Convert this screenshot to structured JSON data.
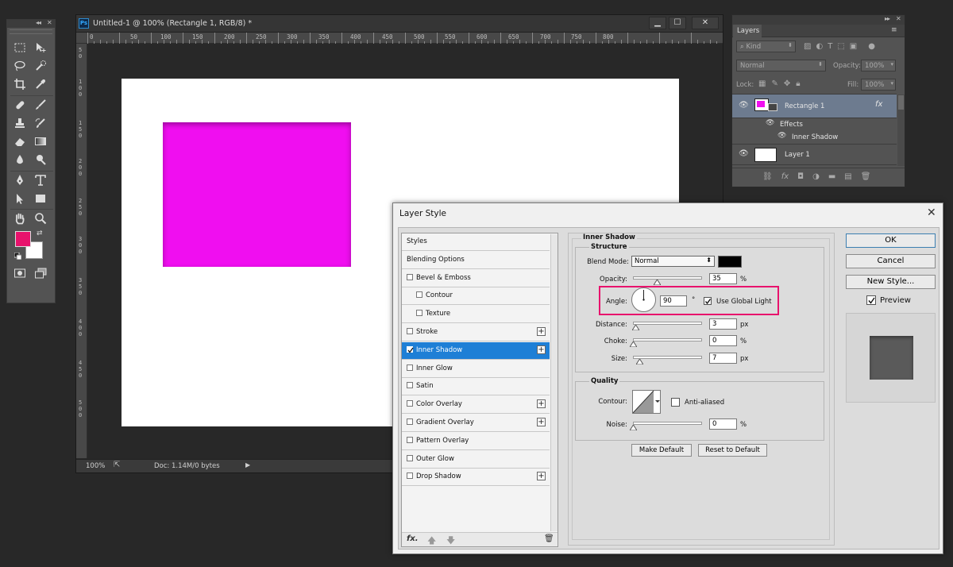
{
  "colors": {
    "app_bg": "#282828",
    "panel": "#535353",
    "accent_select": "#1e7fd6",
    "highlight_box": "#e8126c",
    "shape_fill": "#f00ef0",
    "fg_swatch": "#e8126c",
    "bg_swatch": "#ffffff"
  },
  "document": {
    "title": "Untitled-1 @ 100% (Rectangle 1, RGB/8) *",
    "ps_badge": "Ps",
    "ruler_h": [
      "0",
      "50",
      "100",
      "150",
      "200",
      "250",
      "300",
      "350",
      "400",
      "450",
      "500",
      "550",
      "600",
      "650",
      "700",
      "750",
      "800"
    ],
    "ruler_v": [
      "5 0",
      "1 0 0",
      "1 5 0",
      "2 0 0",
      "2 5 0",
      "3 0 0",
      "3 5 0",
      "4 0 0",
      "4 5 0",
      "5 0 0"
    ],
    "status": {
      "zoom": "100%",
      "doc": "Doc: 1.14M/0 bytes"
    },
    "win_buttons": {
      "minimize": "▁",
      "maximize": "☐",
      "close": "✕"
    }
  },
  "tools": {
    "collapse": "◂◂",
    "close": "✕"
  },
  "layers_panel": {
    "collapse": "▸▸",
    "close": "✕",
    "tab": "Layers",
    "menu": "≡",
    "filter_kind": "Kind",
    "blend_mode": "Normal",
    "opacity_label": "Opacity:",
    "opacity_value": "100%",
    "lock_label": "Lock:",
    "fill_label": "Fill:",
    "fill_value": "100%",
    "layers": [
      {
        "name": "Rectangle 1",
        "fx": "fx"
      },
      {
        "name": "Effects"
      },
      {
        "name": "Inner Shadow"
      },
      {
        "name": "Layer 1"
      }
    ]
  },
  "dialog": {
    "title": "Layer Style",
    "close": "✕",
    "styles_list": [
      {
        "label": "Styles",
        "checkbox": false,
        "indent": false,
        "plus": false,
        "checked": false
      },
      {
        "label": "Blending Options",
        "checkbox": false,
        "indent": false,
        "plus": false,
        "checked": false
      },
      {
        "label": "Bevel & Emboss",
        "checkbox": true,
        "indent": false,
        "plus": false,
        "checked": false
      },
      {
        "label": "Contour",
        "checkbox": true,
        "indent": true,
        "plus": false,
        "checked": false
      },
      {
        "label": "Texture",
        "checkbox": true,
        "indent": true,
        "plus": false,
        "checked": false
      },
      {
        "label": "Stroke",
        "checkbox": true,
        "indent": false,
        "plus": true,
        "checked": false
      },
      {
        "label": "Inner Shadow",
        "checkbox": true,
        "indent": false,
        "plus": true,
        "checked": true,
        "selected": true
      },
      {
        "label": "Inner Glow",
        "checkbox": true,
        "indent": false,
        "plus": false,
        "checked": false
      },
      {
        "label": "Satin",
        "checkbox": true,
        "indent": false,
        "plus": false,
        "checked": false
      },
      {
        "label": "Color Overlay",
        "checkbox": true,
        "indent": false,
        "plus": true,
        "checked": false
      },
      {
        "label": "Gradient Overlay",
        "checkbox": true,
        "indent": false,
        "plus": true,
        "checked": false
      },
      {
        "label": "Pattern Overlay",
        "checkbox": true,
        "indent": false,
        "plus": false,
        "checked": false
      },
      {
        "label": "Outer Glow",
        "checkbox": true,
        "indent": false,
        "plus": false,
        "checked": false
      },
      {
        "label": "Drop Shadow",
        "checkbox": true,
        "indent": false,
        "plus": true,
        "checked": false
      }
    ],
    "section_title": "Inner Shadow",
    "structure": {
      "title": "Structure",
      "blend_mode_label": "Blend Mode:",
      "blend_mode_value": "Normal",
      "shadow_color": "#000000",
      "opacity_label": "Opacity:",
      "opacity_value": "35",
      "opacity_fraction": 0.35,
      "angle_label": "Angle:",
      "angle_value": "90",
      "degree": "°",
      "use_global_light": "Use Global Light",
      "use_global_light_checked": true,
      "distance_label": "Distance:",
      "distance_value": "3",
      "distance_fraction": 0.0,
      "choke_label": "Choke:",
      "choke_value": "0",
      "choke_fraction": 0.0,
      "size_label": "Size:",
      "size_value": "7",
      "size_fraction": 0.03,
      "unit_percent": "%",
      "unit_px": "px"
    },
    "quality": {
      "title": "Quality",
      "contour_label": "Contour:",
      "anti_aliased": "Anti-aliased",
      "anti_aliased_checked": false,
      "noise_label": "Noise:",
      "noise_value": "0",
      "noise_fraction": 0.0
    },
    "make_default": "Make Default",
    "reset_default": "Reset to Default",
    "ok": "OK",
    "cancel": "Cancel",
    "new_style": "New Style...",
    "preview_label": "Preview",
    "preview_checked": true
  }
}
